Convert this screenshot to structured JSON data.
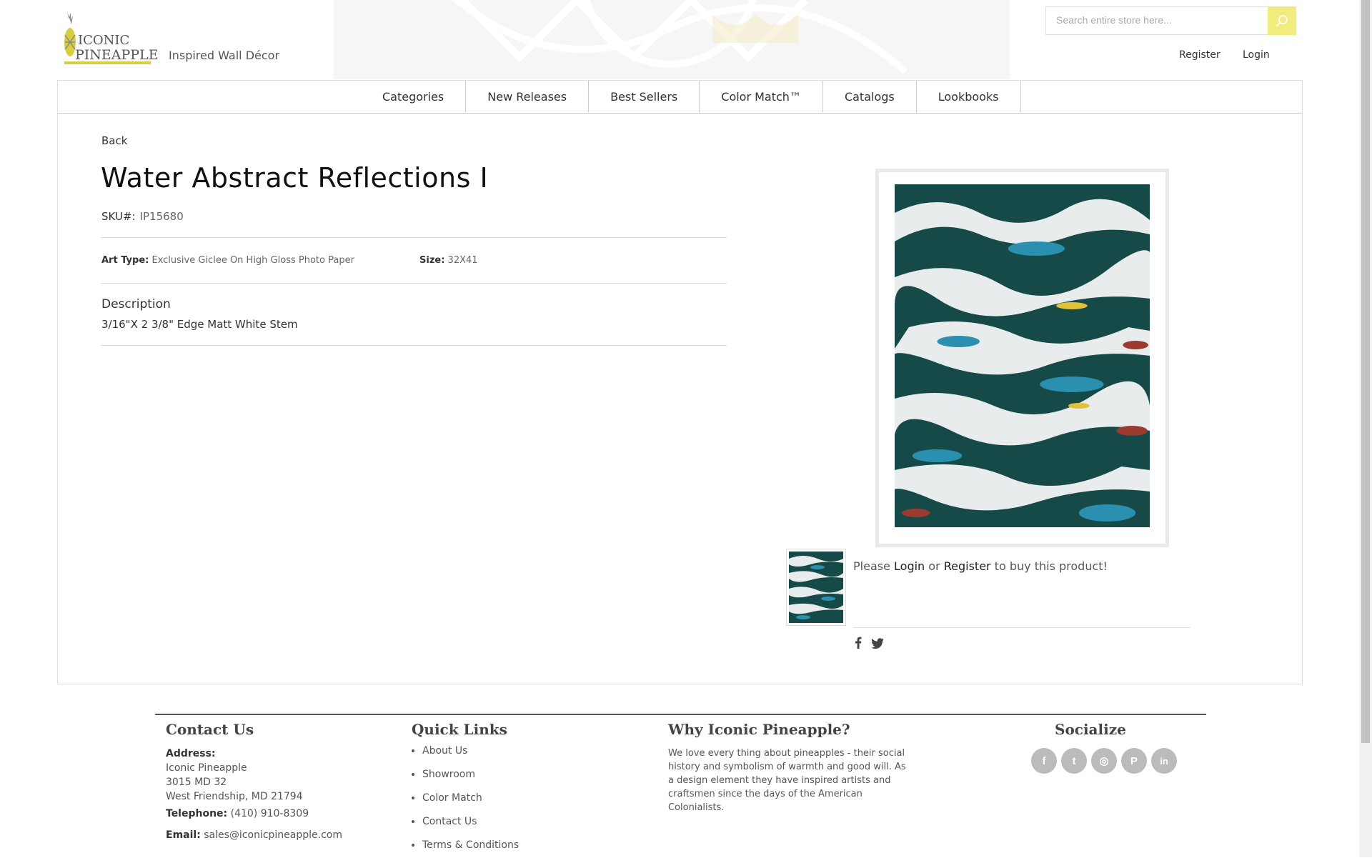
{
  "brand": {
    "logo_line1": "ICONIC",
    "logo_line2": "PINEAPPLE",
    "tagline": "Inspired Wall Décor",
    "accent_color": "#d7cf3f"
  },
  "search": {
    "placeholder": "Search entire store here...",
    "icon": "search-icon"
  },
  "account": {
    "register": "Register",
    "login": "Login"
  },
  "nav": [
    "Categories",
    "New Releases",
    "Best Sellers",
    "Color Match™",
    "Catalogs",
    "Lookbooks"
  ],
  "product": {
    "back": "Back",
    "title": "Water Abstract Reflections I",
    "sku_label": "SKU#:",
    "sku": "IP15680",
    "art_type_label": "Art Type:",
    "art_type": "Exclusive Giclee On High Gloss Photo Paper",
    "size_label": "Size:",
    "size": "32X41",
    "description_heading": "Description",
    "description": "3/16\"X 2 3/8\" Edge Matt White Stem",
    "buy_prefix": "Please",
    "buy_login": "Login",
    "buy_or": "or",
    "buy_register": "Register",
    "buy_suffix": "to buy this product!",
    "share_icons": [
      "facebook-icon",
      "twitter-icon"
    ]
  },
  "footer": {
    "contact": {
      "heading": "Contact Us",
      "address_label": "Address:",
      "address_name": "Iconic Pineapple",
      "address_line1": "3015 MD 32",
      "address_line2": "West Friendship, MD 21794",
      "telephone_label": "Telephone:",
      "telephone": "(410) 910-8309",
      "email_label": "Email:",
      "email": "sales@iconicpineapple.com"
    },
    "quick_links": {
      "heading": "Quick Links",
      "items": [
        "About Us",
        "Showroom",
        "Color Match",
        "Contact Us",
        "Terms & Conditions"
      ]
    },
    "why": {
      "heading": "Why Iconic Pineapple?",
      "text": "We love every thing about pineapples - their social history and symbolism of warmth and good will. As a design element they have inspired artists and craftsmen since the days of the American Colonialists."
    },
    "socialize": {
      "heading": "Socialize",
      "icons": [
        {
          "name": "facebook-icon",
          "glyph": "f"
        },
        {
          "name": "twitter-icon",
          "glyph": "t"
        },
        {
          "name": "instagram-icon",
          "glyph": "◎"
        },
        {
          "name": "pinterest-icon",
          "glyph": "P"
        },
        {
          "name": "linkedin-icon",
          "glyph": "in"
        }
      ]
    }
  }
}
